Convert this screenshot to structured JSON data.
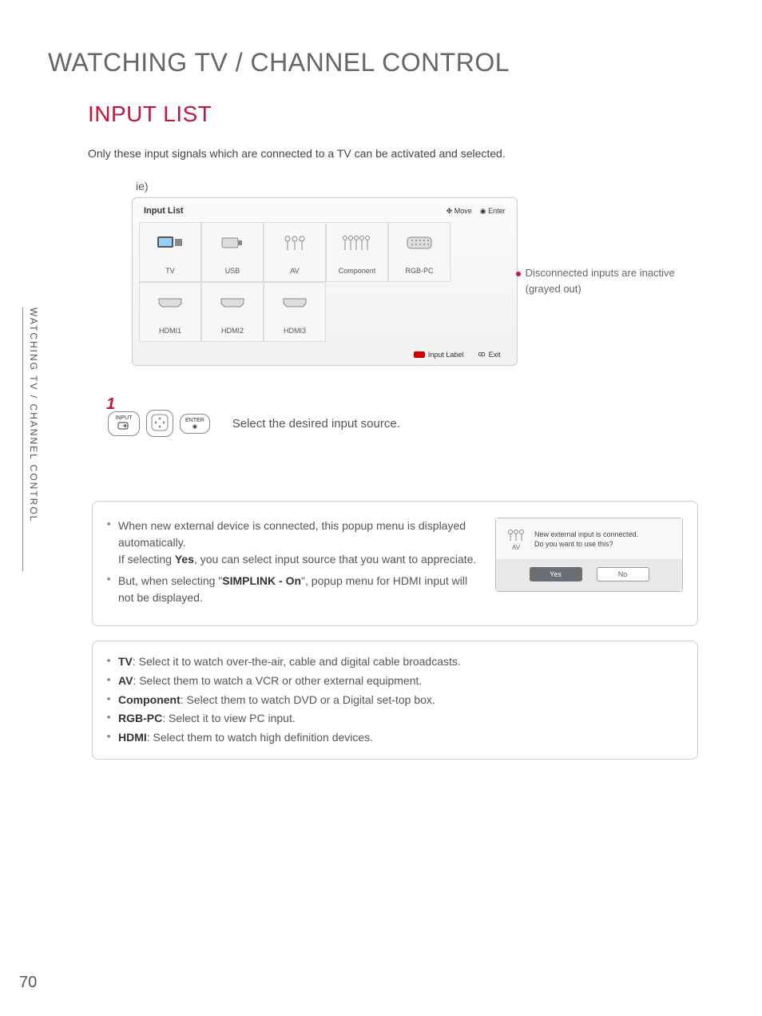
{
  "page": {
    "number": "70",
    "sidebar_label": "WATCHING TV / CHANNEL CONTROL",
    "main_title": "WATCHING TV / CHANNEL CONTROL",
    "sub_title": "INPUT LIST",
    "intro": "Only these input signals which are connected to a TV can be activated and selected.",
    "ie_label": "ie)"
  },
  "panel": {
    "title": "Input List",
    "hint_move": "Move",
    "hint_enter": "Enter",
    "inputs": [
      {
        "label": "TV",
        "icon": "tv-icon"
      },
      {
        "label": "USB",
        "icon": "usb-icon"
      },
      {
        "label": "AV",
        "icon": "av-icon"
      },
      {
        "label": "Component",
        "icon": "component-icon"
      },
      {
        "label": "RGB-PC",
        "icon": "rgbpc-icon"
      },
      {
        "label": "HDMI1",
        "icon": "hdmi-icon"
      },
      {
        "label": "HDMI2",
        "icon": "hdmi-icon"
      },
      {
        "label": "HDMI3",
        "icon": "hdmi-icon"
      }
    ],
    "footer_input_label": "Input Label",
    "footer_exit": "Exit"
  },
  "side_note": {
    "line1": "Disconnected inputs are inactive",
    "line2": "(grayed out)"
  },
  "step": {
    "number": "1",
    "btn_input_top": "INPUT",
    "btn_enter": "ENTER",
    "text": "Select the desired input source."
  },
  "info": {
    "li1a": "When new external device is connected, this popup menu is displayed automatically.",
    "li1b_pre": "If selecting ",
    "li1b_bold": "Yes",
    "li1b_post": ", you can select input source that you want to appreciate.",
    "li2_pre": "But, when selecting \"",
    "li2_bold": "SIMPLINK - On",
    "li2_post": "\", popup menu for HDMI input will not be displayed."
  },
  "popup": {
    "icon_label": "AV",
    "msg1": "New external input is connected.",
    "msg2": "Do you want to use this?",
    "yes": "Yes",
    "no": "No"
  },
  "defs": {
    "tv_b": "TV",
    "tv": ": Select it to watch over-the-air, cable and digital cable broadcasts.",
    "av_b": "AV",
    "av": ": Select them to watch a VCR or other external equipment.",
    "comp_b": "Component",
    "comp": ": Select them to watch DVD or a Digital set-top box.",
    "rgb_b": "RGB-PC",
    "rgb": ": Select it to view PC input.",
    "hdmi_b": "HDMI",
    "hdmi": ": Select them to watch high definition devices."
  }
}
